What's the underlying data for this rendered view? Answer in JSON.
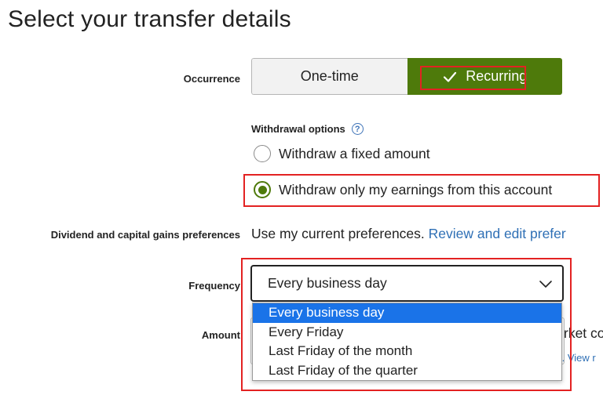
{
  "page": {
    "title": "Select your transfer details"
  },
  "occurrence": {
    "label": "Occurrence",
    "options": [
      "One-time",
      "Recurring"
    ],
    "selected": "Recurring"
  },
  "withdrawal": {
    "heading": "Withdrawal options",
    "help_icon": "question-circle-icon",
    "help_glyph": "?",
    "options": [
      {
        "label": "Withdraw a fixed amount",
        "checked": false
      },
      {
        "label": "Withdraw only my earnings from this account",
        "checked": true
      }
    ]
  },
  "dividend": {
    "label": "Dividend and capital gains preferences",
    "text": "Use my current preferences. ",
    "link": "Review and edit prefer"
  },
  "frequency": {
    "label": "Frequency",
    "value": "Every business day",
    "options": [
      "Every business day",
      "Every Friday",
      "Last Friday of the month",
      "Last Friday of the quarter"
    ],
    "highlighted_index": 0
  },
  "amount": {
    "label": "Amount",
    "obscured_text": "rket co",
    "obscured_link": "t. View r"
  },
  "colors": {
    "accent_green": "#4e7a0b",
    "highlight_red": "#e32222",
    "link_blue": "#2e6fb5",
    "option_selected_blue": "#1a73e8"
  }
}
